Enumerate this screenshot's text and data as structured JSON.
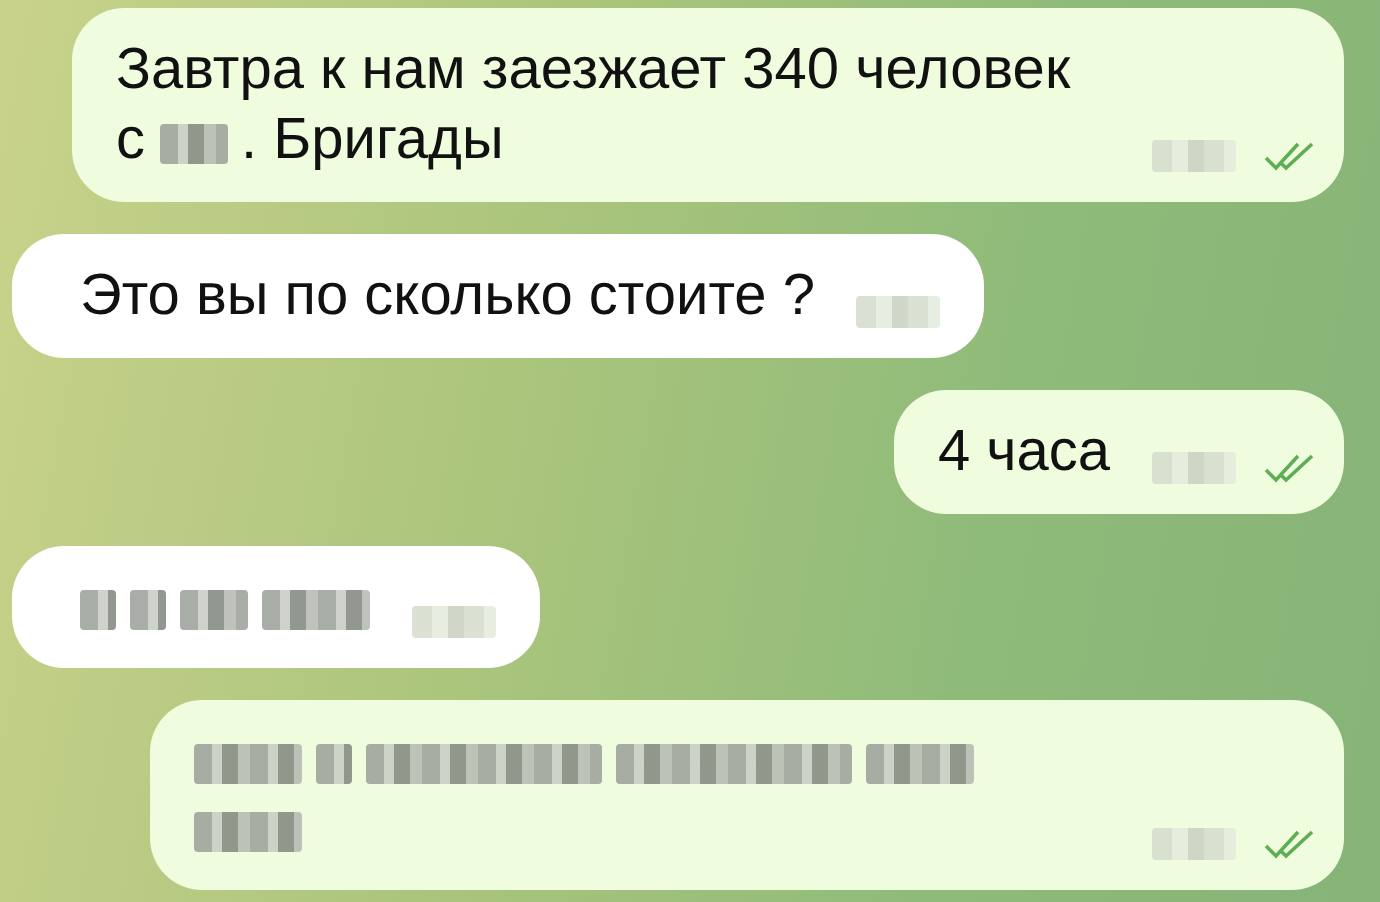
{
  "messages": [
    {
      "kind": "outgoing",
      "time_hidden": true,
      "read": true,
      "segments": [
        {
          "kind": "text",
          "text": "Завтра к нам заезжает 340 человек"
        },
        {
          "kind": "break"
        },
        {
          "kind": "text",
          "text": "с"
        },
        {
          "kind": "blur"
        },
        {
          "kind": "text",
          "text": ". Бригады"
        }
      ]
    },
    {
      "kind": "incoming",
      "time_hidden": true,
      "read": false,
      "segments": [
        {
          "kind": "text",
          "text": "Это вы по сколько стоите ?"
        }
      ]
    },
    {
      "kind": "outgoing",
      "time_hidden": true,
      "read": true,
      "segments": [
        {
          "kind": "text",
          "text": "4 часа"
        }
      ]
    },
    {
      "kind": "incoming",
      "time_hidden": true,
      "read": false,
      "segments": [
        {
          "kind": "dot"
        },
        {
          "kind": "dot"
        },
        {
          "kind": "blur"
        },
        {
          "kind": "smudge"
        }
      ]
    },
    {
      "kind": "outgoing",
      "time_hidden": true,
      "read": true,
      "segments": [
        {
          "kind": "smudge"
        },
        {
          "kind": "dot"
        },
        {
          "kind": "smear"
        },
        {
          "kind": "smear"
        },
        {
          "kind": "smudge"
        },
        {
          "kind": "break"
        },
        {
          "kind": "smudge"
        }
      ]
    }
  ]
}
